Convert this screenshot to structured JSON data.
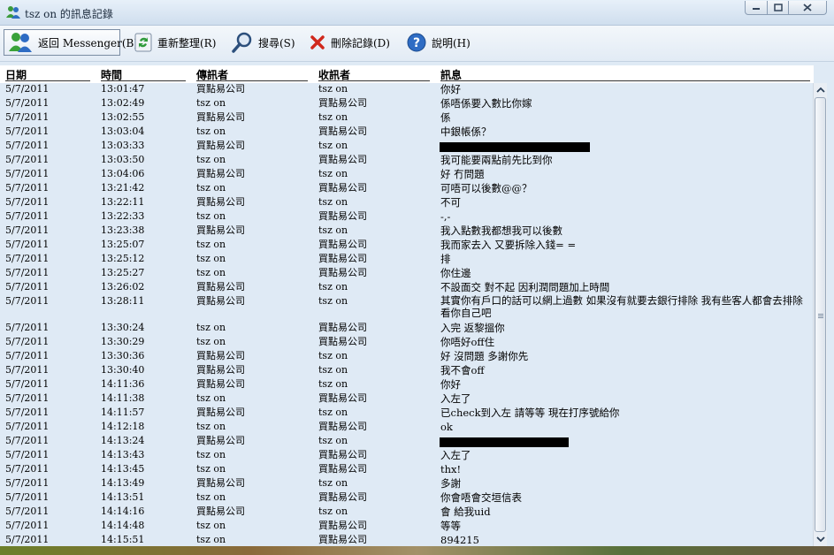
{
  "window": {
    "title": "tsz on 的訊息記錄"
  },
  "toolbar": {
    "back_label": "返回 Messenger(B)",
    "refresh_label": "重新整理(R)",
    "search_label": "搜尋(S)",
    "delete_label": "刪除記錄(D)",
    "help_label": "說明(H)"
  },
  "columns": {
    "date": "日期",
    "time": "時間",
    "sender": "傳訊者",
    "receiver": "收訊者",
    "message": "訊息"
  },
  "rows": [
    {
      "date": "5/7/2011",
      "time": "13:01:47",
      "sender": "買點易公司",
      "receiver": "tsz on",
      "message": "你好"
    },
    {
      "date": "5/7/2011",
      "time": "13:02:49",
      "sender": "tsz on",
      "receiver": "買點易公司",
      "message": "係唔係要入數比你嫁"
    },
    {
      "date": "5/7/2011",
      "time": "13:02:55",
      "sender": "買點易公司",
      "receiver": "tsz on",
      "message": "係"
    },
    {
      "date": "5/7/2011",
      "time": "13:03:04",
      "sender": "tsz on",
      "receiver": "買點易公司",
      "message": "中銀帳係？"
    },
    {
      "date": "5/7/2011",
      "time": "13:03:33",
      "sender": "買點易公司",
      "receiver": "tsz on",
      "message": "",
      "redacted": 170
    },
    {
      "date": "5/7/2011",
      "time": "13:03:50",
      "sender": "tsz on",
      "receiver": "買點易公司",
      "message": "我可能要兩點前先比到你"
    },
    {
      "date": "5/7/2011",
      "time": "13:04:06",
      "sender": "買點易公司",
      "receiver": "tsz on",
      "message": "好 冇問題"
    },
    {
      "date": "5/7/2011",
      "time": "13:21:42",
      "sender": "tsz on",
      "receiver": "買點易公司",
      "message": "可唔可以後數@@？"
    },
    {
      "date": "5/7/2011",
      "time": "13:22:11",
      "sender": "買點易公司",
      "receiver": "tsz on",
      "message": "不可"
    },
    {
      "date": "5/7/2011",
      "time": "13:22:33",
      "sender": "tsz on",
      "receiver": "買點易公司",
      "message": "-,-"
    },
    {
      "date": "5/7/2011",
      "time": "13:23:38",
      "sender": "買點易公司",
      "receiver": "tsz on",
      "message": "我入點數我都想我可以後數"
    },
    {
      "date": "5/7/2011",
      "time": "13:25:07",
      "sender": "tsz on",
      "receiver": "買點易公司",
      "message": "我而家去入 又要拆除入錢= ="
    },
    {
      "date": "5/7/2011",
      "time": "13:25:12",
      "sender": "tsz on",
      "receiver": "買點易公司",
      "message": "排"
    },
    {
      "date": "5/7/2011",
      "time": "13:25:27",
      "sender": "tsz on",
      "receiver": "買點易公司",
      "message": "你住邊"
    },
    {
      "date": "5/7/2011",
      "time": "13:26:02",
      "sender": "買點易公司",
      "receiver": "tsz on",
      "message": "不設面交 對不起 因利潤問題加上時間"
    },
    {
      "date": "5/7/2011",
      "time": "13:28:11",
      "sender": "買點易公司",
      "receiver": "tsz on",
      "message": "其實你有戶口的話可以網上過數 如果沒有就要去銀行排除 我有些客人都會去排除 看你自己吧",
      "tall": true
    },
    {
      "date": "5/7/2011",
      "time": "13:30:24",
      "sender": "tsz on",
      "receiver": "買點易公司",
      "message": "入完 返黎搵你"
    },
    {
      "date": "5/7/2011",
      "time": "13:30:29",
      "sender": "tsz on",
      "receiver": "買點易公司",
      "message": "你唔好off住"
    },
    {
      "date": "5/7/2011",
      "time": "13:30:36",
      "sender": "買點易公司",
      "receiver": "tsz on",
      "message": "好 沒問題 多謝你先"
    },
    {
      "date": "5/7/2011",
      "time": "13:30:40",
      "sender": "買點易公司",
      "receiver": "tsz on",
      "message": "我不會off"
    },
    {
      "date": "5/7/2011",
      "time": "14:11:36",
      "sender": "買點易公司",
      "receiver": "tsz on",
      "message": "你好"
    },
    {
      "date": "5/7/2011",
      "time": "14:11:38",
      "sender": "tsz on",
      "receiver": "買點易公司",
      "message": "入左了"
    },
    {
      "date": "5/7/2011",
      "time": "14:11:57",
      "sender": "買點易公司",
      "receiver": "tsz on",
      "message": "已check到入左 請等等 現在打序號給你"
    },
    {
      "date": "5/7/2011",
      "time": "14:12:18",
      "sender": "tsz on",
      "receiver": "買點易公司",
      "message": "ok"
    },
    {
      "date": "5/7/2011",
      "time": "14:13:24",
      "sender": "買點易公司",
      "receiver": "tsz on",
      "message": "",
      "redacted": 146
    },
    {
      "date": "5/7/2011",
      "time": "14:13:43",
      "sender": "tsz on",
      "receiver": "買點易公司",
      "message": "入左了"
    },
    {
      "date": "5/7/2011",
      "time": "14:13:45",
      "sender": "tsz on",
      "receiver": "買點易公司",
      "message": "thx!"
    },
    {
      "date": "5/7/2011",
      "time": "14:13:49",
      "sender": "買點易公司",
      "receiver": "tsz on",
      "message": "多謝"
    },
    {
      "date": "5/7/2011",
      "time": "14:13:51",
      "sender": "tsz on",
      "receiver": "買點易公司",
      "message": "你會唔會交垣信表"
    },
    {
      "date": "5/7/2011",
      "time": "14:14:16",
      "sender": "買點易公司",
      "receiver": "tsz on",
      "message": "會 給我uid"
    },
    {
      "date": "5/7/2011",
      "time": "14:14:48",
      "sender": "tsz on",
      "receiver": "買點易公司",
      "message": "等等"
    },
    {
      "date": "5/7/2011",
      "time": "14:15:51",
      "sender": "tsz on",
      "receiver": "買點易公司",
      "message": "894215"
    }
  ]
}
